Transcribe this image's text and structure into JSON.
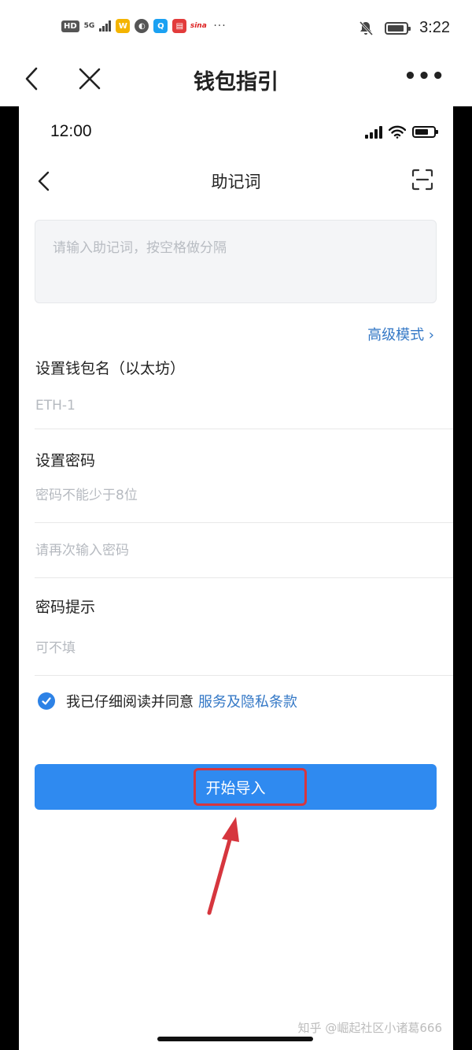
{
  "outer": {
    "status": {
      "time": "3:22",
      "hd": "HD",
      "network": "5G",
      "more": "···"
    },
    "nav": {
      "title": "钱包指引",
      "more": "•••"
    }
  },
  "inner": {
    "status": {
      "time": "12:00"
    },
    "nav": {
      "title": "助记词"
    },
    "mnemonic": {
      "placeholder": "请输入助记词，按空格做分隔"
    },
    "advanced_link": "高级模式 ›",
    "wallet_name": {
      "label": "设置钱包名（以太坊）",
      "placeholder": "ETH-1"
    },
    "password": {
      "label": "设置密码",
      "placeholder": "密码不能少于8位",
      "confirm_placeholder": "请再次输入密码"
    },
    "hint": {
      "label": "密码提示",
      "placeholder": "可不填"
    },
    "agreement": {
      "checked": true,
      "text": "我已仔细阅读并同意",
      "link": "服务及隐私条款"
    },
    "start_button": "开始导入"
  },
  "watermark": "知乎 @崛起社区小诸葛666",
  "colors": {
    "accent": "#2f8af0",
    "link": "#3478c6",
    "highlight": "#d6363e"
  }
}
